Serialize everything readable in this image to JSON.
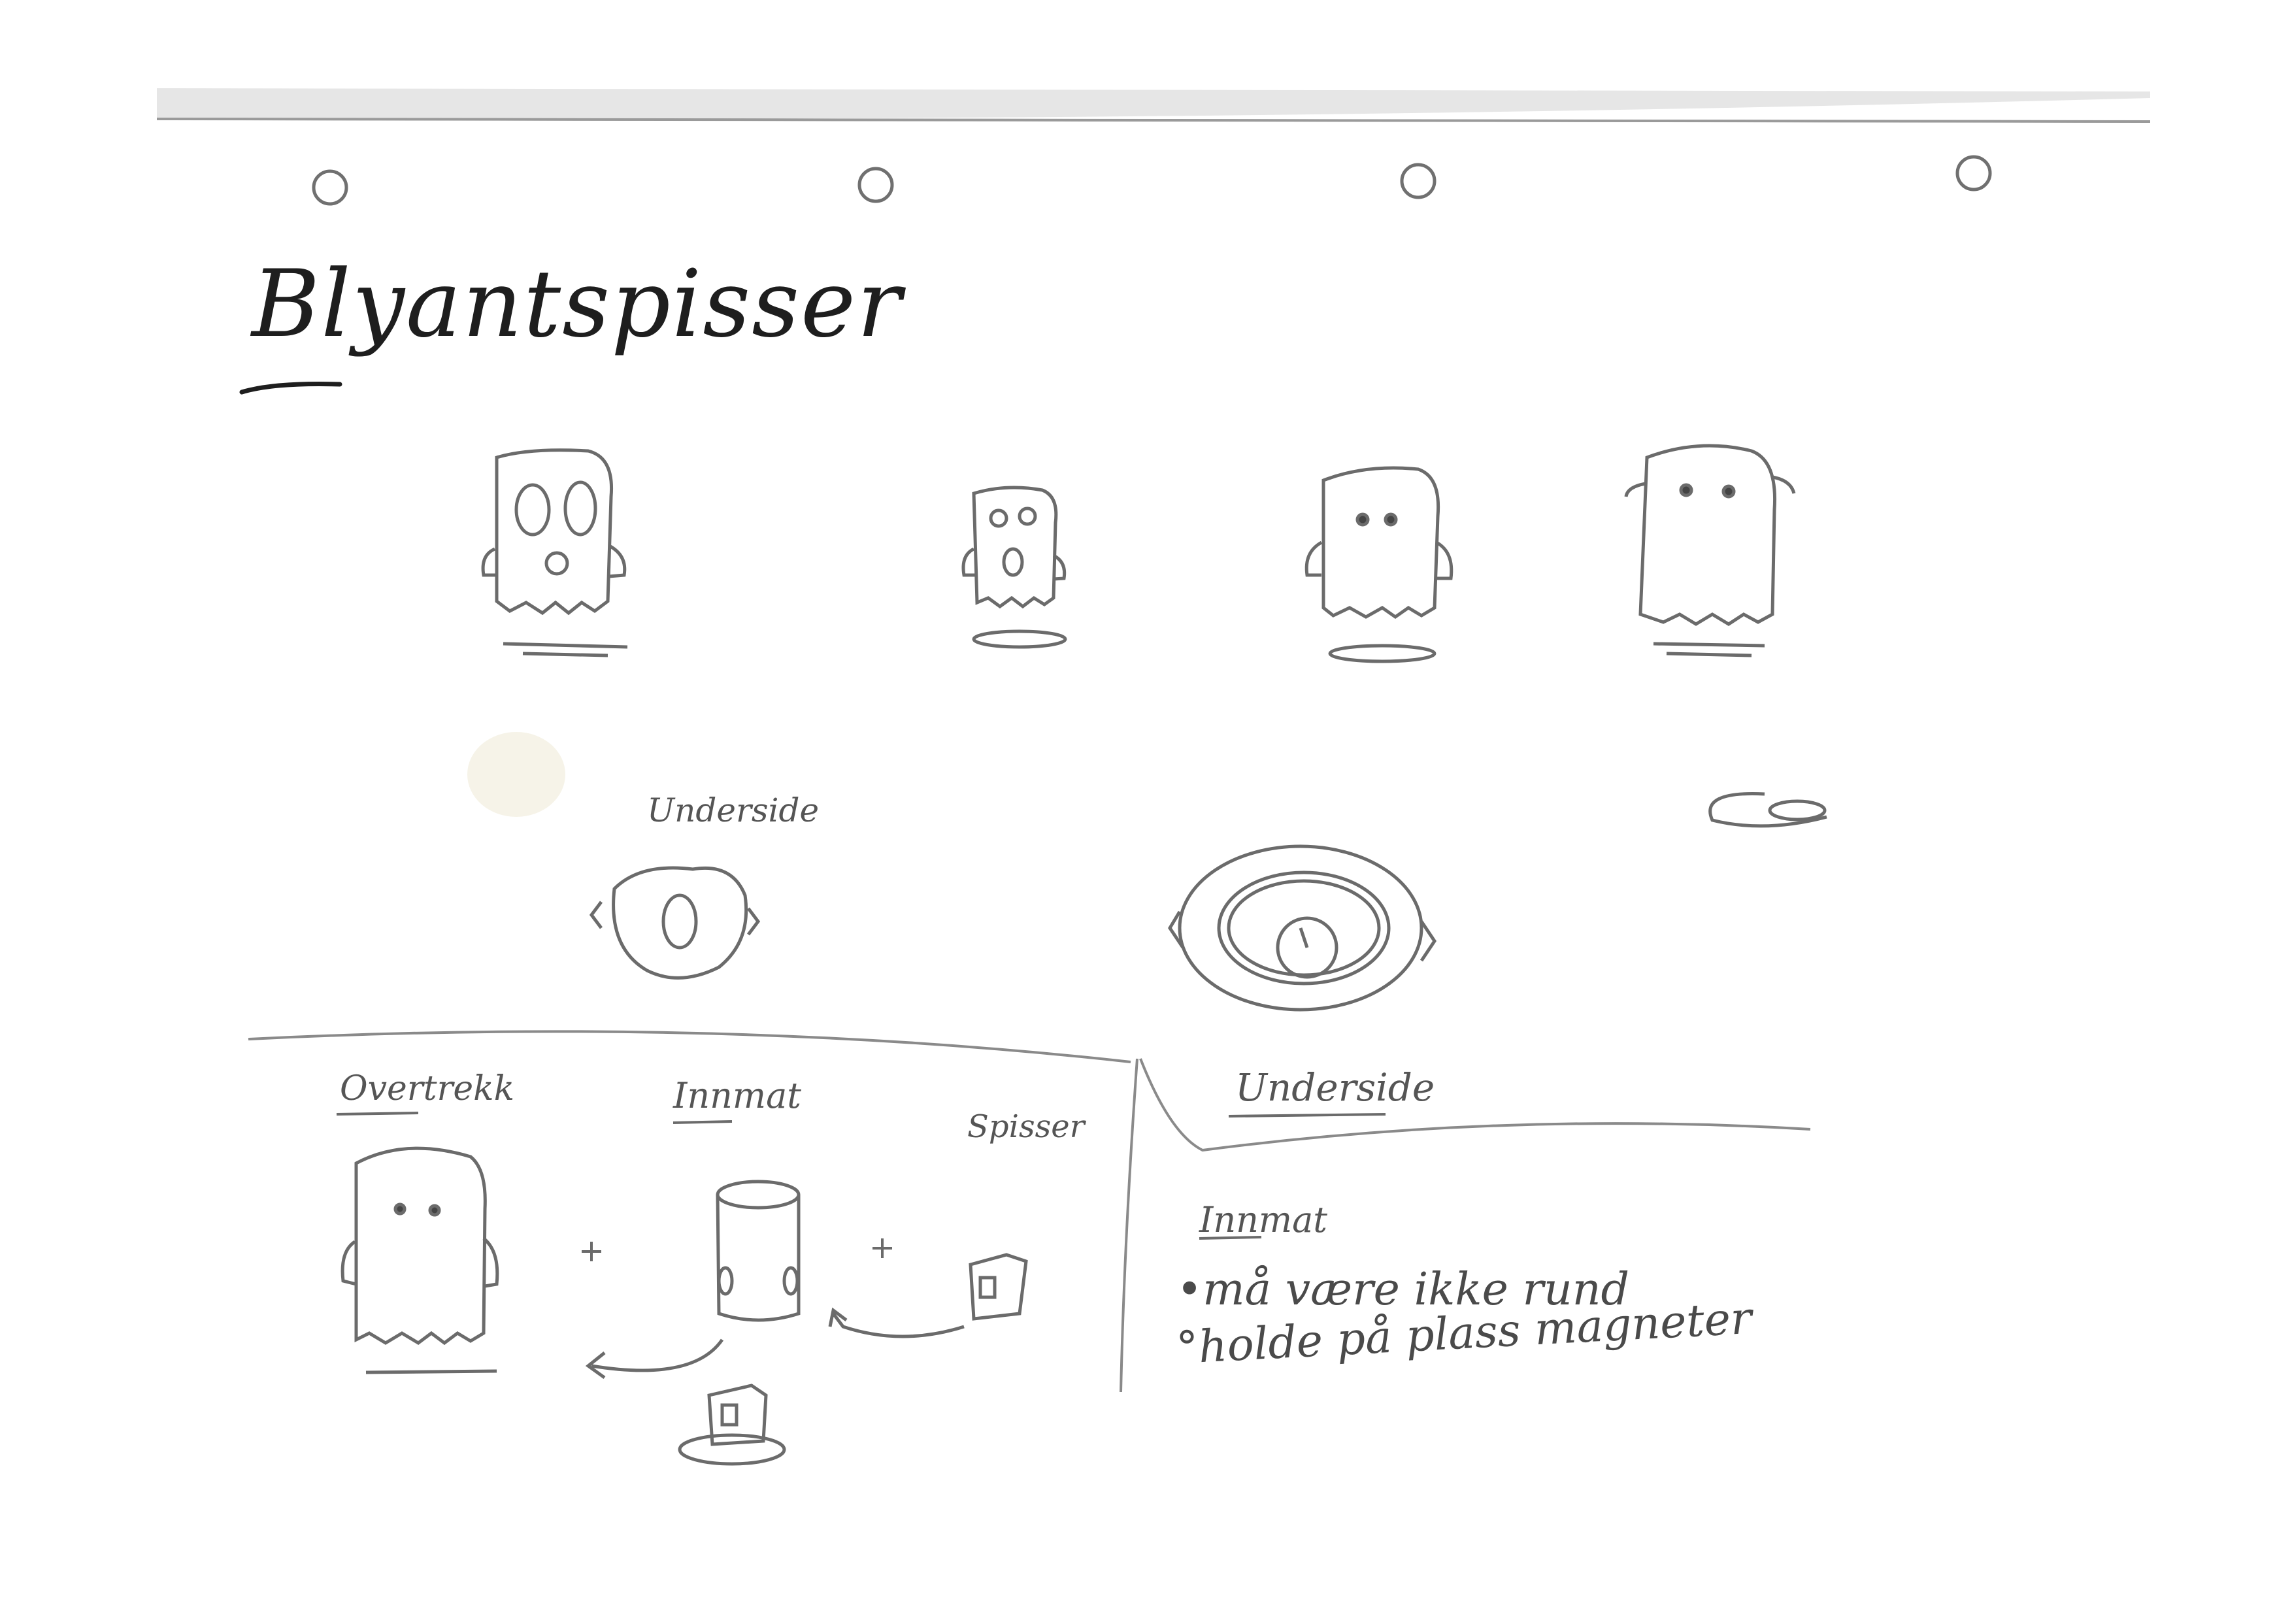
{
  "sketch": {
    "title": "Blyantspisser",
    "underside_label_top": "Underside",
    "underside_label_bottom": "Underside",
    "parts": {
      "cover_label": "Overtrekk",
      "inner_label": "Innmat",
      "sharpener_label": "Spisser"
    },
    "notes": {
      "heading": "Innmat",
      "items": [
        "•må være ikke rund",
        "°holde på plass magneter"
      ]
    }
  },
  "colors": {
    "paper": "#ffffff",
    "pencil": "#6b6b6b",
    "ink": "#1e1e1e"
  }
}
